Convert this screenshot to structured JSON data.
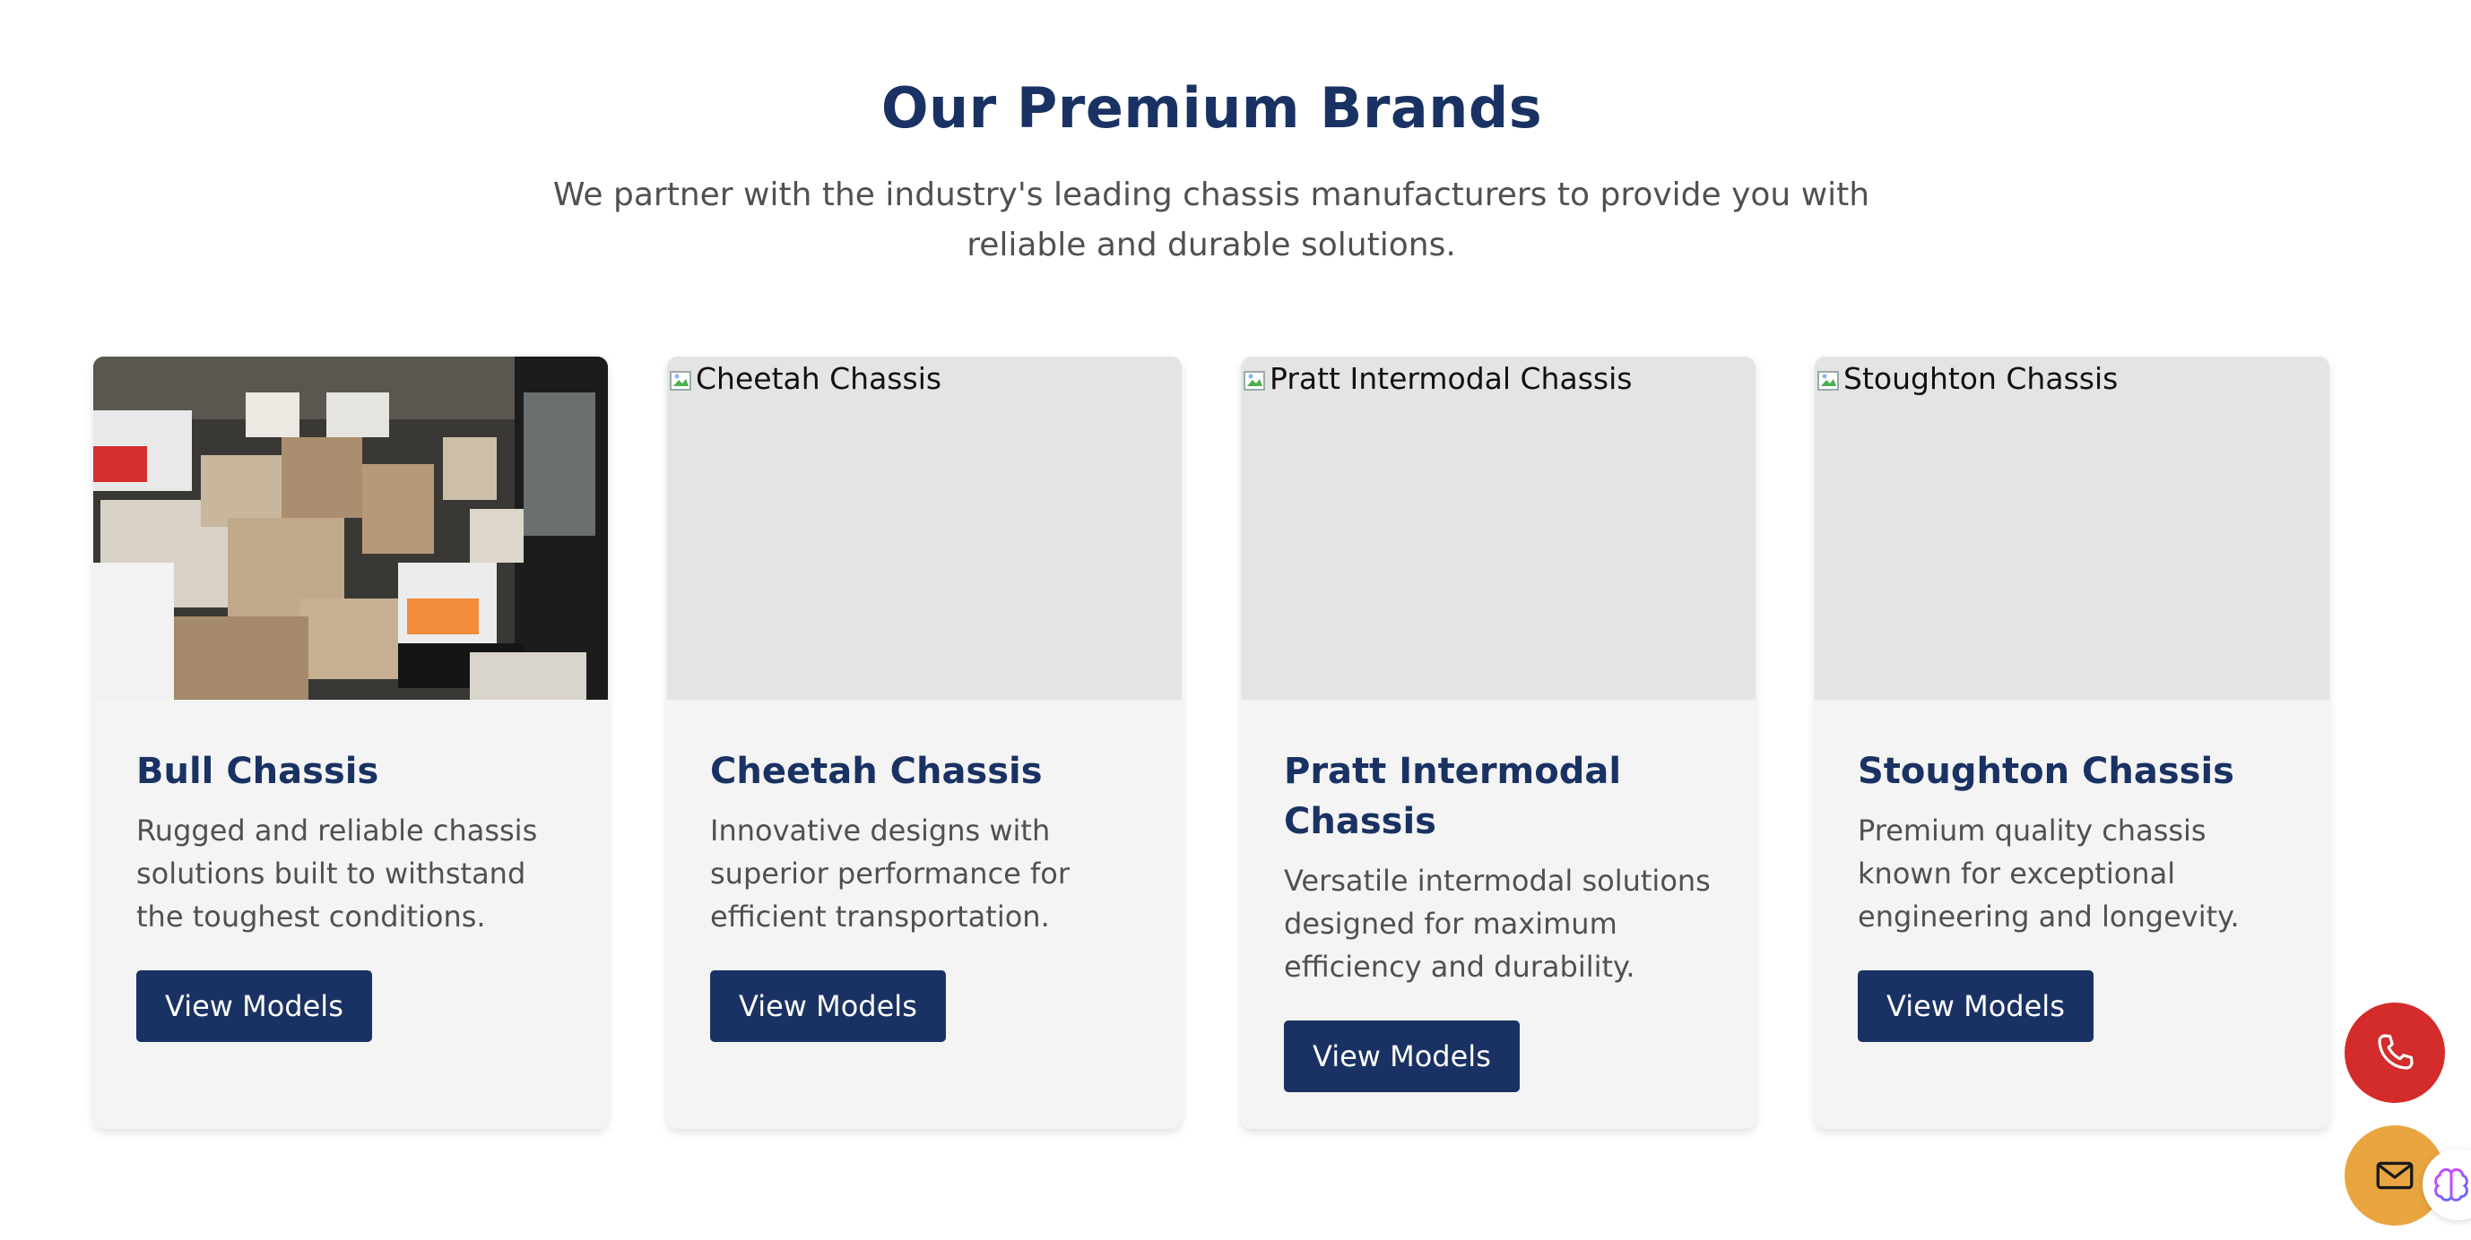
{
  "section": {
    "title": "Our Premium Brands",
    "intro": "We partner with the industry's leading chassis manufacturers to provide you with reliable and durable solutions."
  },
  "brands": [
    {
      "image_alt": "",
      "image": "boxes-photo",
      "title": "Bull Chassis",
      "description": "Rugged and reliable chassis solutions built to withstand the toughest conditions.",
      "button": "View Models"
    },
    {
      "image_alt": "Cheetah Chassis",
      "image": "broken",
      "title": "Cheetah Chassis",
      "description": "Innovative designs with superior performance for efficient transportation.",
      "button": "View Models"
    },
    {
      "image_alt": "Pratt Intermodal Chassis",
      "image": "broken",
      "title": "Pratt Intermodal Chassis",
      "description": "Versatile intermodal solutions designed for maximum efficiency and durability.",
      "button": "View Models"
    },
    {
      "image_alt": "Stoughton Chassis",
      "image": "broken",
      "title": "Stoughton Chassis",
      "description": "Premium quality chassis known for exceptional engineering and longevity.",
      "button": "View Models"
    }
  ],
  "floating": {
    "phone_icon": "phone-icon",
    "mail_icon": "mail-icon",
    "assistant_icon": "brain-icon"
  },
  "colors": {
    "brand_navy": "#1a3263",
    "phone_red": "#d42b2b",
    "mail_amber": "#e9a640",
    "card_bg": "#f4f4f4"
  }
}
